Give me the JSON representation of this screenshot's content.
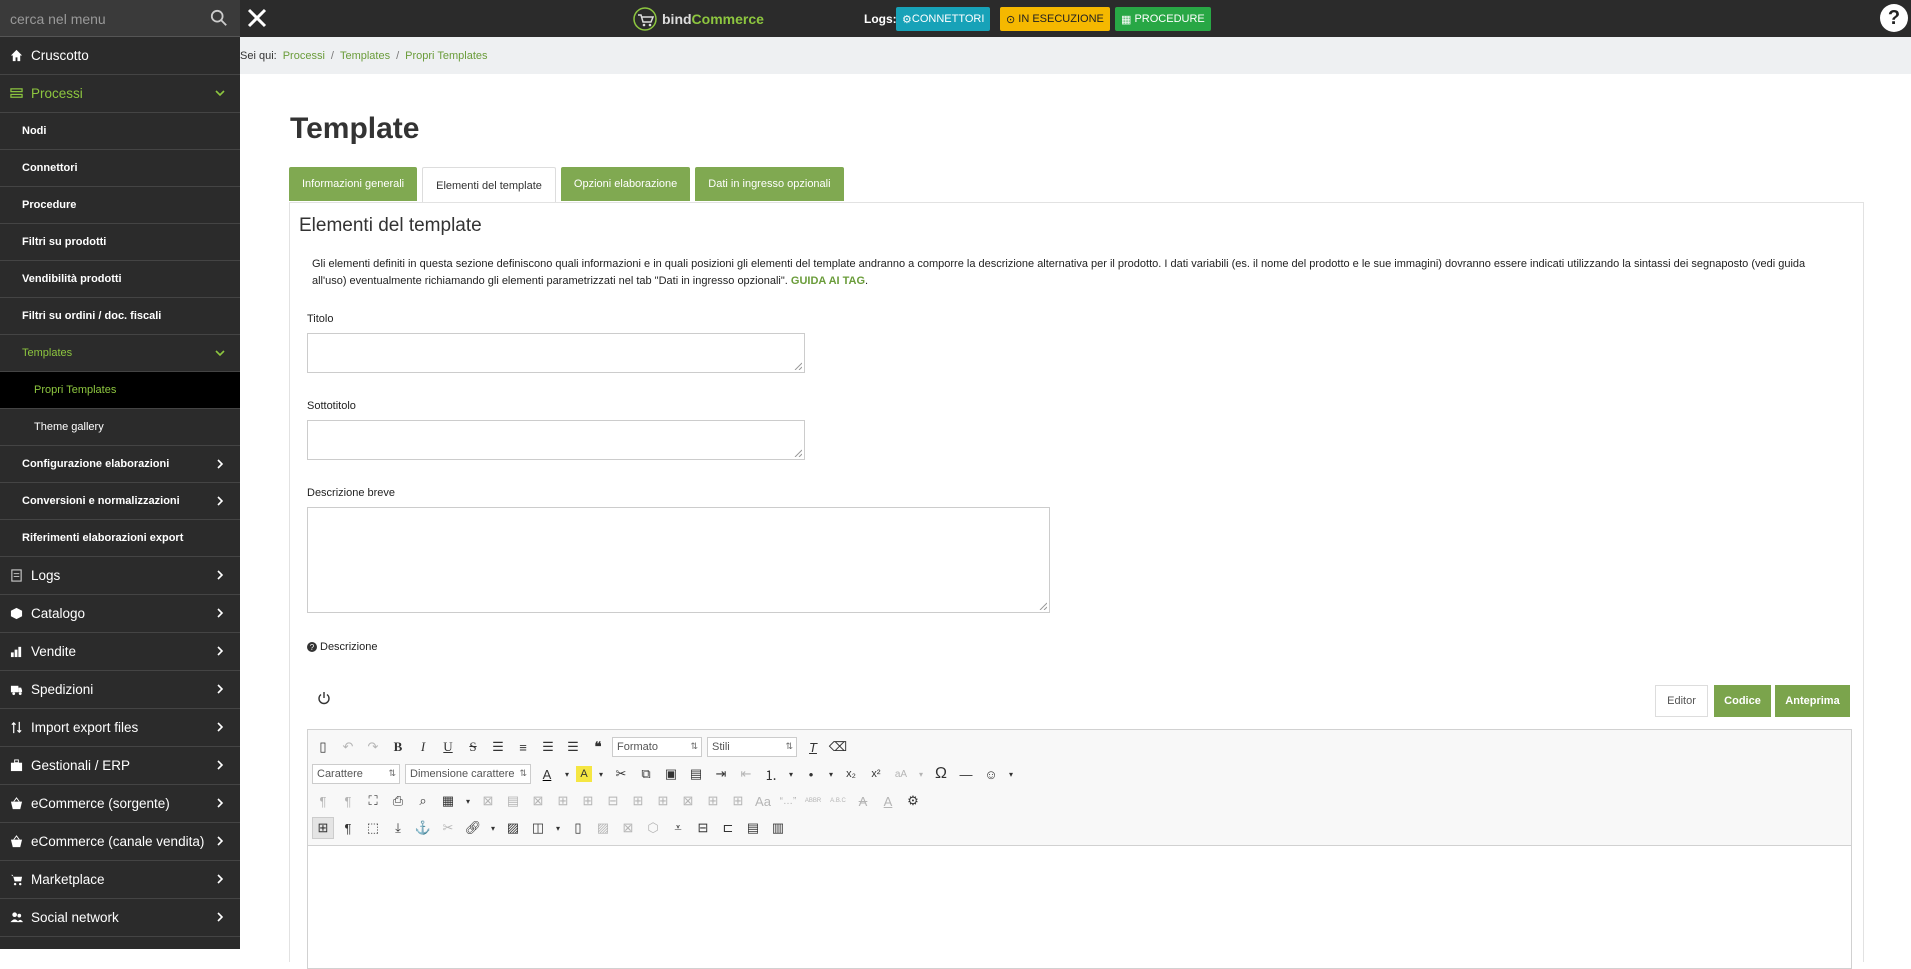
{
  "search": {
    "placeholder": "cerca nel menu"
  },
  "logo": {
    "text_a": "bind",
    "text_b": "Commerce"
  },
  "logs": {
    "label": "Logs:",
    "connettori": "CONNETTORI",
    "in_esecuzione": "IN ESECUZIONE",
    "procedure": "PROCEDURE"
  },
  "help": "?",
  "sidebar": {
    "cruscotto": "Cruscotto",
    "processi": "Processi",
    "nodi": "Nodi",
    "connettori": "Connettori",
    "procedure": "Procedure",
    "filtri_prodotti": "Filtri su prodotti",
    "vendibilita": "Vendibilità prodotti",
    "filtri_ordini": "Filtri su ordini / doc. fiscali",
    "templates": "Templates",
    "propri_templates": "Propri Templates",
    "theme_gallery": "Theme gallery",
    "config_elaborazioni": "Configurazione elaborazioni",
    "conversioni": "Conversioni e normalizzazioni",
    "riferimenti": "Riferimenti elaborazioni export",
    "logs": "Logs",
    "catalogo": "Catalogo",
    "vendite": "Vendite",
    "spedizioni": "Spedizioni",
    "import_export": "Import export files",
    "gestionali": "Gestionali / ERP",
    "ecommerce_sorgente": "eCommerce (sorgente)",
    "ecommerce_vendita": "eCommerce (canale vendita)",
    "marketplace": "Marketplace",
    "social": "Social network"
  },
  "breadcrumb": {
    "label": "Sei qui:",
    "c1": "Processi",
    "c2": "Templates",
    "c3": "Propri Templates",
    "sep": "/"
  },
  "page": {
    "title": "Template",
    "tabs": [
      "Informazioni generali",
      "Elementi del template",
      "Opzioni elaborazione",
      "Dati in ingresso opzionali"
    ],
    "panel_title": "Elementi del template",
    "desc_text": "Gli elementi definiti in questa sezione definiscono quali informazioni e in quali posizioni gli elementi del template andranno a comporre la descrizione alternativa per il prodotto. I dati variabili (es. il nome del prodotto e le sue immagini) dovranno essere indicati utilizzando la sintassi dei segnaposto (vedi guida all'uso) eventualmente richiamando gli elementi parametrizzati nel tab \"Dati in ingresso opzionali\".",
    "desc_link": "GUIDA AI TAG",
    "desc_end": ".",
    "titolo": "Titolo",
    "sottotitolo": "Sottotitolo",
    "descrizione_breve": "Descrizione breve",
    "descrizione": "Descrizione",
    "btn_editor": "Editor",
    "btn_codice": "Codice",
    "btn_anteprima": "Anteprima"
  },
  "editor": {
    "formato": "Formato",
    "stili": "Stili",
    "carattere": "Carattere",
    "dimensione": "Dimensione carattere"
  },
  "colors": {
    "accent": "#8dc63f",
    "tab_green": "#80a951",
    "sidebar_bg": "#2b2b2b"
  }
}
